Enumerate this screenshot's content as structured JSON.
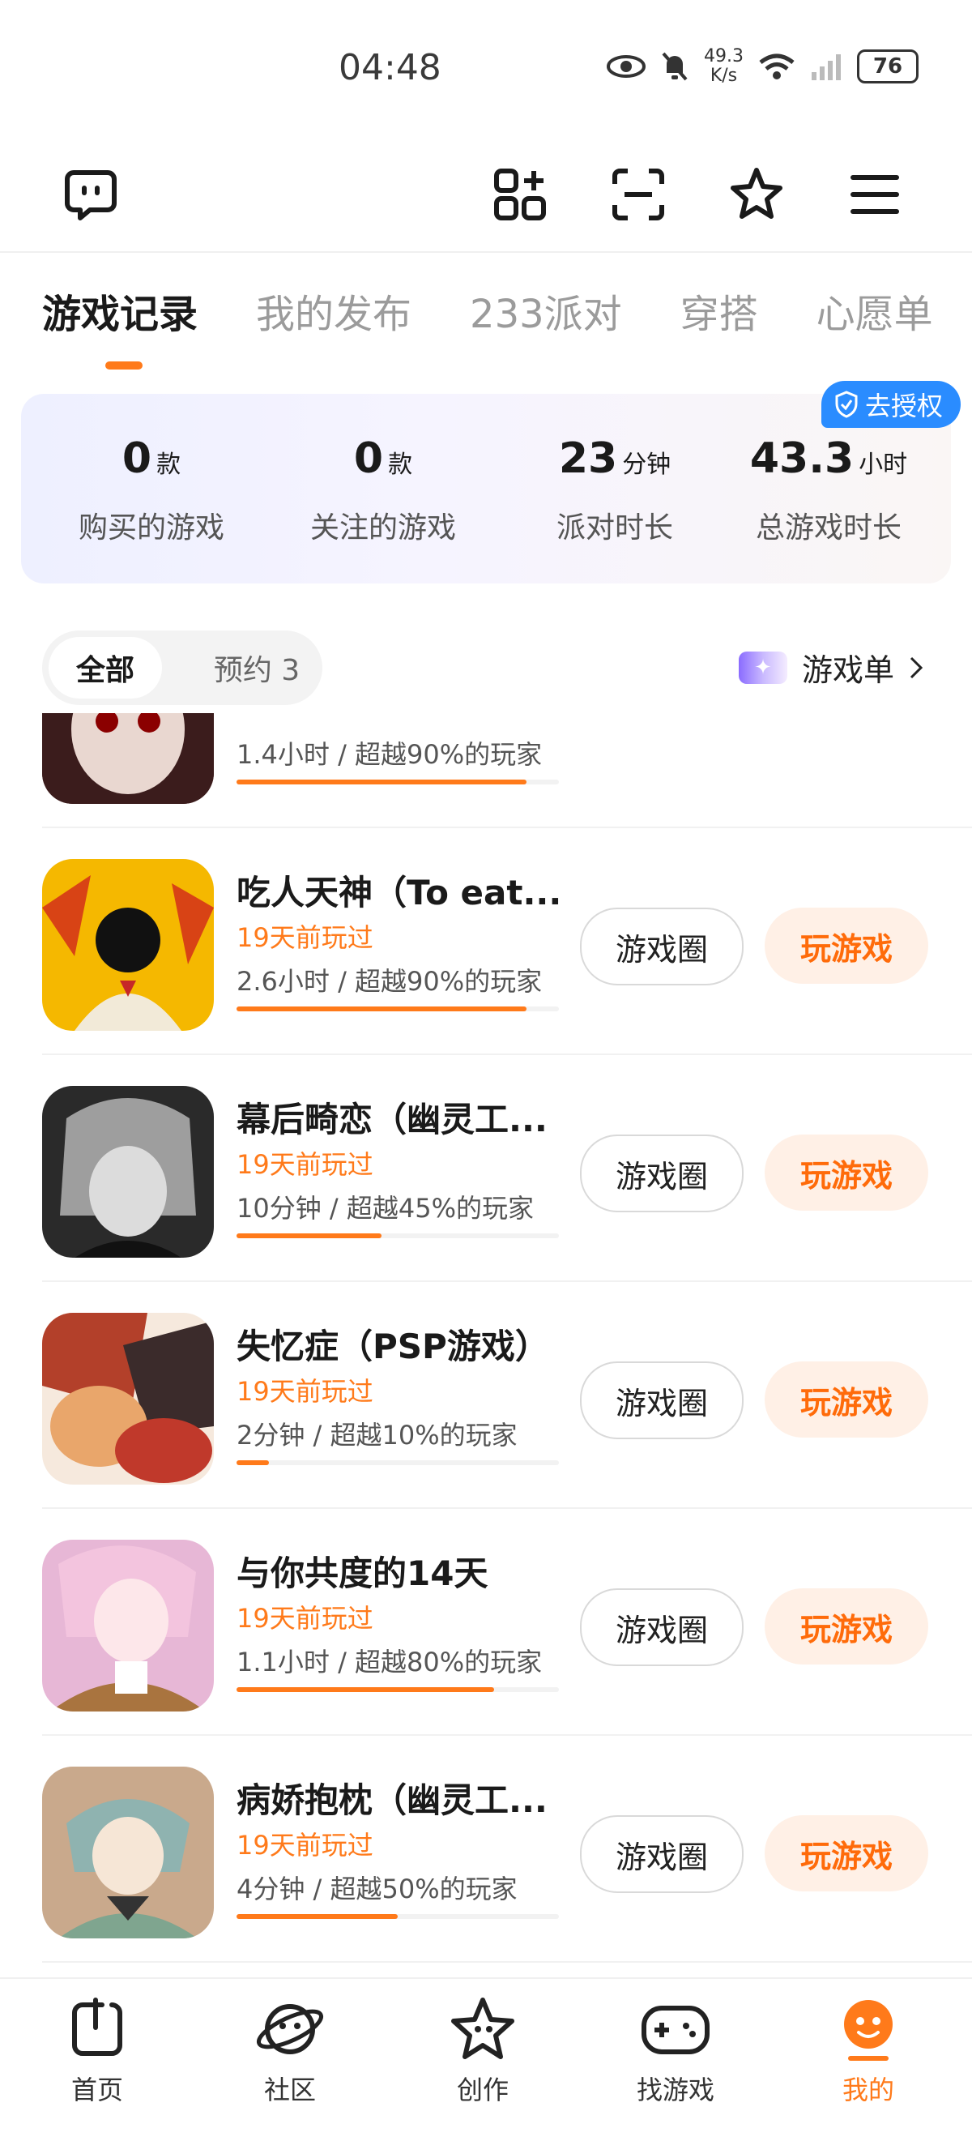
{
  "status_bar": {
    "time": "04:48",
    "net_speed_value": "49.3",
    "net_speed_unit": "K/s",
    "battery": "76"
  },
  "top_icons": [
    "chat-bubble-icon",
    "apps-add-icon",
    "scan-icon",
    "star-badge-icon",
    "menu-icon"
  ],
  "tabs": [
    {
      "label": "游戏记录",
      "active": true
    },
    {
      "label": "我的发布"
    },
    {
      "label": "233派对"
    },
    {
      "label": "穿搭"
    },
    {
      "label": "心愿单"
    }
  ],
  "stats": [
    {
      "value": "0",
      "unit": "款",
      "label": "购买的游戏"
    },
    {
      "value": "0",
      "unit": "款",
      "label": "关注的游戏"
    },
    {
      "value": "23",
      "unit": "分钟",
      "label": "派对时长"
    },
    {
      "value": "43.3",
      "unit": "小时",
      "label": "总游戏时长"
    }
  ],
  "auth_label": "去授权",
  "filter": {
    "all": "全部",
    "reserve": "预约 3"
  },
  "game_list_link": "游戏单",
  "button_labels": {
    "circle": "游戏圈",
    "play": "玩游戏"
  },
  "games": [
    {
      "title": "",
      "played": "",
      "detail": "1.4小时 / 超越90%的玩家",
      "progress": 0.9
    },
    {
      "title": "吃人天神（To eat...",
      "played": "19天前玩过",
      "detail": "2.6小时 / 超越90%的玩家",
      "progress": 0.9
    },
    {
      "title": "幕后畸恋（幽灵工...",
      "played": "19天前玩过",
      "detail": "10分钟 / 超越45%的玩家",
      "progress": 0.45
    },
    {
      "title": "失忆症（PSP游戏）",
      "played": "19天前玩过",
      "detail": "2分钟 / 超越10%的玩家",
      "progress": 0.1
    },
    {
      "title": "与你共度的14天",
      "played": "19天前玩过",
      "detail": "1.1小时 / 超越80%的玩家",
      "progress": 0.8
    },
    {
      "title": "病娇抱枕（幽灵工...",
      "played": "19天前玩过",
      "detail": "4分钟 / 超越50%的玩家",
      "progress": 0.5
    }
  ],
  "nav": [
    {
      "label": "首页",
      "icon": "home-icon"
    },
    {
      "label": "社区",
      "icon": "planet-icon"
    },
    {
      "label": "创作",
      "icon": "create-star-icon"
    },
    {
      "label": "找游戏",
      "icon": "gamepad-icon"
    },
    {
      "label": "我的",
      "icon": "profile-icon",
      "active": true
    }
  ],
  "colors": {
    "accent": "#ff7a1a",
    "auth_blue": "#2a8cff",
    "play_bg": "#fff0e6"
  }
}
